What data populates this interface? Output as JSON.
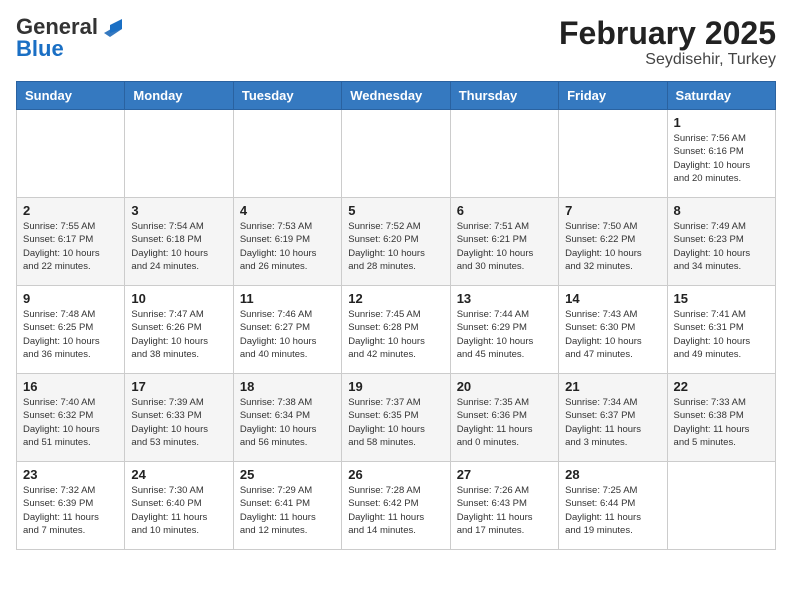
{
  "logo": {
    "general": "General",
    "blue": "Blue"
  },
  "title": "February 2025",
  "subtitle": "Seydisehir, Turkey",
  "days_of_week": [
    "Sunday",
    "Monday",
    "Tuesday",
    "Wednesday",
    "Thursday",
    "Friday",
    "Saturday"
  ],
  "weeks": [
    [
      {
        "day": "",
        "info": ""
      },
      {
        "day": "",
        "info": ""
      },
      {
        "day": "",
        "info": ""
      },
      {
        "day": "",
        "info": ""
      },
      {
        "day": "",
        "info": ""
      },
      {
        "day": "",
        "info": ""
      },
      {
        "day": "1",
        "info": "Sunrise: 7:56 AM\nSunset: 6:16 PM\nDaylight: 10 hours\nand 20 minutes."
      }
    ],
    [
      {
        "day": "2",
        "info": "Sunrise: 7:55 AM\nSunset: 6:17 PM\nDaylight: 10 hours\nand 22 minutes."
      },
      {
        "day": "3",
        "info": "Sunrise: 7:54 AM\nSunset: 6:18 PM\nDaylight: 10 hours\nand 24 minutes."
      },
      {
        "day": "4",
        "info": "Sunrise: 7:53 AM\nSunset: 6:19 PM\nDaylight: 10 hours\nand 26 minutes."
      },
      {
        "day": "5",
        "info": "Sunrise: 7:52 AM\nSunset: 6:20 PM\nDaylight: 10 hours\nand 28 minutes."
      },
      {
        "day": "6",
        "info": "Sunrise: 7:51 AM\nSunset: 6:21 PM\nDaylight: 10 hours\nand 30 minutes."
      },
      {
        "day": "7",
        "info": "Sunrise: 7:50 AM\nSunset: 6:22 PM\nDaylight: 10 hours\nand 32 minutes."
      },
      {
        "day": "8",
        "info": "Sunrise: 7:49 AM\nSunset: 6:23 PM\nDaylight: 10 hours\nand 34 minutes."
      }
    ],
    [
      {
        "day": "9",
        "info": "Sunrise: 7:48 AM\nSunset: 6:25 PM\nDaylight: 10 hours\nand 36 minutes."
      },
      {
        "day": "10",
        "info": "Sunrise: 7:47 AM\nSunset: 6:26 PM\nDaylight: 10 hours\nand 38 minutes."
      },
      {
        "day": "11",
        "info": "Sunrise: 7:46 AM\nSunset: 6:27 PM\nDaylight: 10 hours\nand 40 minutes."
      },
      {
        "day": "12",
        "info": "Sunrise: 7:45 AM\nSunset: 6:28 PM\nDaylight: 10 hours\nand 42 minutes."
      },
      {
        "day": "13",
        "info": "Sunrise: 7:44 AM\nSunset: 6:29 PM\nDaylight: 10 hours\nand 45 minutes."
      },
      {
        "day": "14",
        "info": "Sunrise: 7:43 AM\nSunset: 6:30 PM\nDaylight: 10 hours\nand 47 minutes."
      },
      {
        "day": "15",
        "info": "Sunrise: 7:41 AM\nSunset: 6:31 PM\nDaylight: 10 hours\nand 49 minutes."
      }
    ],
    [
      {
        "day": "16",
        "info": "Sunrise: 7:40 AM\nSunset: 6:32 PM\nDaylight: 10 hours\nand 51 minutes."
      },
      {
        "day": "17",
        "info": "Sunrise: 7:39 AM\nSunset: 6:33 PM\nDaylight: 10 hours\nand 53 minutes."
      },
      {
        "day": "18",
        "info": "Sunrise: 7:38 AM\nSunset: 6:34 PM\nDaylight: 10 hours\nand 56 minutes."
      },
      {
        "day": "19",
        "info": "Sunrise: 7:37 AM\nSunset: 6:35 PM\nDaylight: 10 hours\nand 58 minutes."
      },
      {
        "day": "20",
        "info": "Sunrise: 7:35 AM\nSunset: 6:36 PM\nDaylight: 11 hours\nand 0 minutes."
      },
      {
        "day": "21",
        "info": "Sunrise: 7:34 AM\nSunset: 6:37 PM\nDaylight: 11 hours\nand 3 minutes."
      },
      {
        "day": "22",
        "info": "Sunrise: 7:33 AM\nSunset: 6:38 PM\nDaylight: 11 hours\nand 5 minutes."
      }
    ],
    [
      {
        "day": "23",
        "info": "Sunrise: 7:32 AM\nSunset: 6:39 PM\nDaylight: 11 hours\nand 7 minutes."
      },
      {
        "day": "24",
        "info": "Sunrise: 7:30 AM\nSunset: 6:40 PM\nDaylight: 11 hours\nand 10 minutes."
      },
      {
        "day": "25",
        "info": "Sunrise: 7:29 AM\nSunset: 6:41 PM\nDaylight: 11 hours\nand 12 minutes."
      },
      {
        "day": "26",
        "info": "Sunrise: 7:28 AM\nSunset: 6:42 PM\nDaylight: 11 hours\nand 14 minutes."
      },
      {
        "day": "27",
        "info": "Sunrise: 7:26 AM\nSunset: 6:43 PM\nDaylight: 11 hours\nand 17 minutes."
      },
      {
        "day": "28",
        "info": "Sunrise: 7:25 AM\nSunset: 6:44 PM\nDaylight: 11 hours\nand 19 minutes."
      },
      {
        "day": "",
        "info": ""
      }
    ]
  ]
}
